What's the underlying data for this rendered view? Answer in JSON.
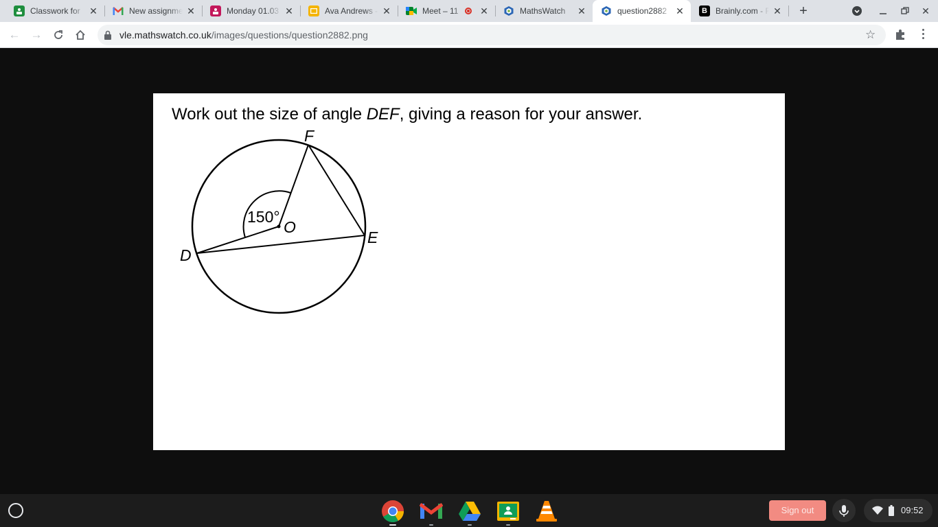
{
  "tabs": [
    {
      "title": "Classwork for",
      "icon": "google-classroom-icon",
      "active": false
    },
    {
      "title": "New assignment",
      "icon": "gmail-icon",
      "active": false
    },
    {
      "title": "Monday 01.03",
      "icon": "google-classroom-icon",
      "active": false
    },
    {
      "title": "Ava Andrews -",
      "icon": "google-slides-icon",
      "active": false
    },
    {
      "title": "Meet – 11",
      "icon": "google-meet-icon",
      "active": false,
      "recording": true
    },
    {
      "title": "MathsWatch",
      "icon": "mathswatch-icon",
      "active": false
    },
    {
      "title": "question2882",
      "icon": "mathswatch-icon",
      "active": true
    },
    {
      "title": "Brainly.com - F",
      "icon": "brainly-icon",
      "active": false
    }
  ],
  "address_bar": {
    "host": "vle.mathswatch.co.uk",
    "path": "/images/questions/question2882.png"
  },
  "question": {
    "prefix": "Work out the size of angle ",
    "angle_name": "DEF",
    "suffix": ", giving a reason for your answer."
  },
  "diagram": {
    "labels": {
      "F": "F",
      "O": "O",
      "D": "D",
      "E": "E"
    },
    "angle_label": "150°"
  },
  "shelf": {
    "apps": [
      {
        "name": "chrome-app",
        "running": true
      },
      {
        "name": "gmail-app",
        "running": true
      },
      {
        "name": "google-drive-app",
        "running": true
      },
      {
        "name": "google-classroom-app",
        "running": true
      },
      {
        "name": "vlc-app",
        "running": false
      }
    ],
    "sign_out_label": "Sign out",
    "time": "09:52"
  },
  "colors": {
    "tabstrip": "#dee1e6",
    "page_background": "#0e0e0e",
    "shelf": "#1c1c1c",
    "sign_out": "#f28b82"
  }
}
